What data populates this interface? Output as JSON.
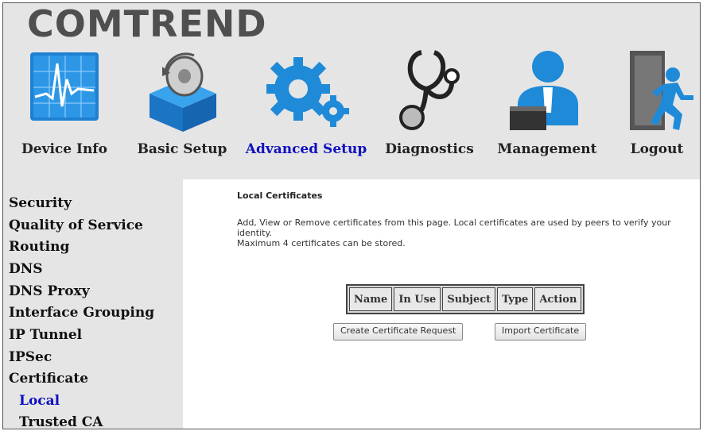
{
  "brand": {
    "logo_text": "COMTREND"
  },
  "nav": {
    "items": [
      {
        "label": "Device Info",
        "icon": "device-info-icon"
      },
      {
        "label": "Basic Setup",
        "icon": "basic-setup-icon"
      },
      {
        "label": "Advanced Setup",
        "icon": "advanced-setup-icon",
        "active": true
      },
      {
        "label": "Diagnostics",
        "icon": "diagnostics-icon"
      },
      {
        "label": "Management",
        "icon": "management-icon"
      },
      {
        "label": "Logout",
        "icon": "logout-icon"
      }
    ]
  },
  "sidebar": {
    "items": [
      {
        "label": "Security"
      },
      {
        "label": "Quality of Service"
      },
      {
        "label": "Routing"
      },
      {
        "label": "DNS"
      },
      {
        "label": "DNS Proxy"
      },
      {
        "label": "Interface Grouping"
      },
      {
        "label": "IP Tunnel"
      },
      {
        "label": "IPSec"
      },
      {
        "label": "Certificate"
      },
      {
        "label": "Local",
        "sub": true,
        "active": true
      },
      {
        "label": "Trusted CA",
        "sub": true
      }
    ]
  },
  "main": {
    "title": "Local Certificates",
    "description_line1": "Add, View or Remove certificates from this page. Local certificates are used by peers to verify your identity.",
    "description_line2": "Maximum 4 certificates can be stored.",
    "table": {
      "columns": [
        "Name",
        "In Use",
        "Subject",
        "Type",
        "Action"
      ]
    },
    "buttons": {
      "create": "Create Certificate Request",
      "import": "Import Certificate"
    }
  },
  "colors": {
    "active_link": "#1010c0",
    "icon_blue": "#1f8ad8",
    "background": "#e5e5e5"
  }
}
